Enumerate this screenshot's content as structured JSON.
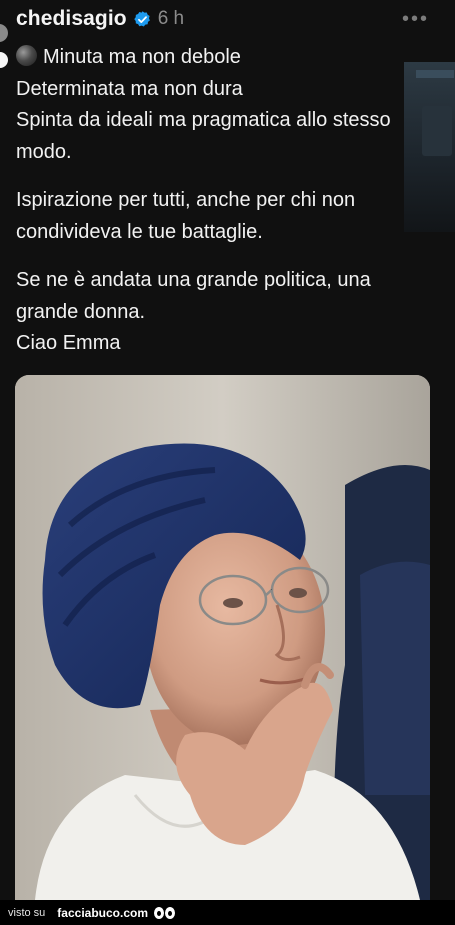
{
  "post": {
    "username": "chedisagio",
    "time": "6 h",
    "more_icon": "•••",
    "lines": [
      "Minuta ma non debole",
      "Determinata ma non dura",
      "Spinta da ideali ma pragmatica allo stesso modo.",
      "Ispirazione per tutti, anche per chi non condivideva le tue battaglie.",
      "Se ne è andata una grande politica, una grande donna.",
      "Ciao Emma"
    ]
  },
  "footer": {
    "visto_su": "visto su",
    "brand": "facciabuco.com"
  },
  "colors": {
    "background": "#101010",
    "verified": "#1d9bf0",
    "muted": "#8c8c8c"
  },
  "icons": {
    "verified": "verified-badge-icon",
    "bullet": "black-circle-icon",
    "more": "more-options-icon",
    "logo": "eyes-logo-icon"
  }
}
